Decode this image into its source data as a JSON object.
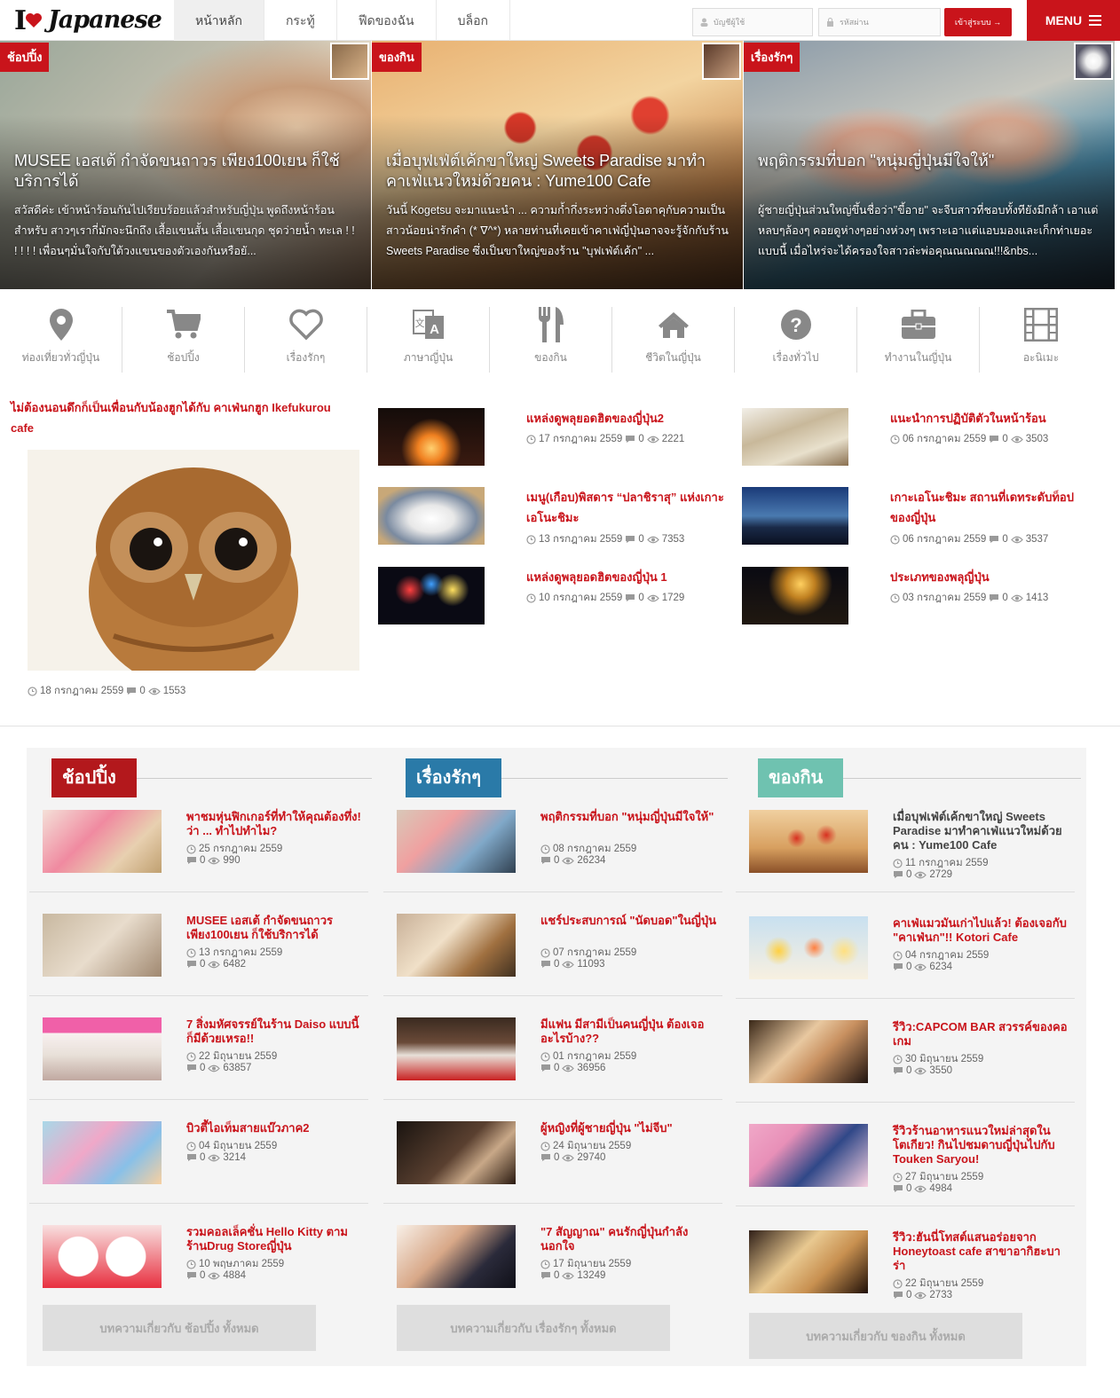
{
  "header": {
    "logo_text": "Japanese",
    "nav": [
      "หน้าหลัก",
      "กระทู้",
      "ฟีดของฉัน",
      "บล็อก"
    ],
    "username_placeholder": "บัญชีผู้ใช้",
    "password_placeholder": "รหัสผ่าน",
    "login_label": "เข้าสู่ระบบ →",
    "menu_label": "MENU"
  },
  "slides": [
    {
      "tag": "ช้อปปิ้ง",
      "title": "MUSEE เอสเต้ กำจัดขนถาวร เพียง100เยน ก็ใช้บริการได้",
      "excerpt": "สวัสดีค่ะ เข้าหน้าร้อนกันไปเรียบร้อยแล้วสำหรับญี่ปุ่น พูดถึงหน้าร้อนสำหรับ สาวๆเรากี่มักจะนึกถึง เสื้อแขนสั้น เสื้อแขนกุด ชุดว่ายน้ำ ทะเล ! ! ! ! ! ! เพื่อนๆมั่นใจกับใต้วงแขนของตัวเองกันหรือยั..."
    },
    {
      "tag": "ของกิน",
      "title": "เมื่อบุฟเฟ่ต์เค้กขาใหญ่ Sweets Paradise มาทำคาเฟ่แนวใหม่ด้วยคน : Yume100 Cafe",
      "excerpt": "วันนี้ Kogetsu จะมาแนะนำ ... ความก้ำกึ่งระหว่างตึ่งโอตาคุกับความเป็นสาวน้อยน่ารักคำ (* ∇^*) หลายท่านที่เคยเข้าคาเฟ่ญี่ปุ่นอาจจะรู้จักกับร้าน Sweets Paradise ซึ่งเป็นขาใหญ่ของร้าน \"บุฟเฟ่ต์เค้ก\" ..."
    },
    {
      "tag": "เรื่องรักๆ",
      "title": "พฤติกรรมที่บอก \"หนุ่มญี่ปุ่นมีใจให้\"",
      "excerpt": "ผู้ชายญี่ปุ่นส่วนใหญ่ขึ้นชื่อว่า\"ขี้อาย\" จะจีบสาวที่ชอบทั้งทียังมีกล้า เอาแต่หลบๆล้องๆ คอยดูห่างๆอย่างห่วงๆ เพราะเอาแต่แอบมองและเก็กท่าเยอะแบบนี้ เมื่อไหร่จะได้ครองใจสาวล่ะพ่อคุณณณณณ!!!&nbs..."
    }
  ],
  "categories": [
    "ท่องเที่ยวทั่วญี่ปุ่น",
    "ช้อปปิ้ง",
    "เรื่องรักๆ",
    "ภาษาญี่ปุ่น",
    "ของกิน",
    "ชีวิตในญี่ปุ่น",
    "เรื่องทั่วไป",
    "ทำงานในญี่ปุ่น",
    "อะนิเมะ"
  ],
  "featured": {
    "title": "ไม่ต้องนอนดึกก็เป็นเพื่อนกับน้องฮูกได้กับ คาเฟ่นกฮูก Ikefukurou cafe",
    "date": "18 กรกฎาคม 2559",
    "comments": "0",
    "views": "1553"
  },
  "latest": [
    {
      "title": "แหล่งดูพลุยอดฮิตของญี่ปุ่น2",
      "date": "17 กรกฎาคม 2559",
      "comments": "0",
      "views": "2221"
    },
    {
      "title": "แนะนำการปฏิบัติตัวในหน้าร้อน",
      "date": "06 กรกฎาคม 2559",
      "comments": "0",
      "views": "3503"
    },
    {
      "title": "เมนู(เกือบ)พิสดาร “ปลาชิราสุ” แห่งเกาะเอโนะชิมะ",
      "date": "13 กรกฎาคม 2559",
      "comments": "0",
      "views": "7353"
    },
    {
      "title": "เกาะเอโนะชิมะ สถานที่เดทระดับท็อปของญี่ปุ่น",
      "date": "06 กรกฎาคม 2559",
      "comments": "0",
      "views": "3537"
    },
    {
      "title": "แหล่งดูพลุยอดฮิตของญี่ปุ่น 1",
      "date": "10 กรกฎาคม 2559",
      "comments": "0",
      "views": "1729"
    },
    {
      "title": "ประเภทของพลุญี่ปุ่น",
      "date": "03 กรกฎาคม 2559",
      "comments": "0",
      "views": "1413"
    }
  ],
  "columns": [
    {
      "label": "ช้อปปิ้ง",
      "color": "#b3181c",
      "more": "บทความเกี่ยวกับ ช้อปปิ้ง ทั้งหมด",
      "posts": [
        {
          "title": "พาชมหุ่นฟิกเกอร์ที่ทำให้คุณต้องทึ่ง! ว่า ... ทำไปทำไม?",
          "date": "25 กรกฎาคม 2559",
          "comments": "0",
          "views": "990"
        },
        {
          "title": "MUSEE เอสเต้ กำจัดขนถาวร เพียง100เยน ก็ใช้บริการได้",
          "date": "13 กรกฎาคม 2559",
          "comments": "0",
          "views": "6482"
        },
        {
          "title": "7 สิ่งมหัศจรรย์ในร้าน Daiso แบบนี้ก็มีด้วยเหรอ!!",
          "date": "22 มิถุนายน 2559",
          "comments": "0",
          "views": "63857"
        },
        {
          "title": "บิวตี้ไอเท็มสายแบ๊วภาค2",
          "date": "04 มิถุนายน 2559",
          "comments": "0",
          "views": "3214"
        },
        {
          "title": "รวมคอลเล็คชั่น Hello Kitty ตามร้านDrug Storeญี่ปุ่น",
          "date": "10 พฤษภาคม 2559",
          "comments": "0",
          "views": "4884"
        }
      ]
    },
    {
      "label": "เรื่องรักๆ",
      "color": "#2a7aa8",
      "more": "บทความเกี่ยวกับ เรื่องรักๆ ทั้งหมด",
      "posts": [
        {
          "title": "พฤติกรรมที่บอก \"หนุ่มญี่ปุ่นมีใจให้\"",
          "date": "08 กรกฎาคม 2559",
          "comments": "0",
          "views": "26234"
        },
        {
          "title": "แชร์ประสบการณ์ \"นัดบอด\"ในญี่ปุ่น",
          "date": "07 กรกฎาคม 2559",
          "comments": "0",
          "views": "11093"
        },
        {
          "title": "มีแฟน มีสามีเป็นคนญี่ปุ่น ต้องเจออะไรบ้าง??",
          "date": "01 กรกฎาคม 2559",
          "comments": "0",
          "views": "36956"
        },
        {
          "title": "ผู้หญิงที่ผู้ชายญี่ปุ่น \"ไม่จีบ\"",
          "date": "24 มิถุนายน 2559",
          "comments": "0",
          "views": "29740"
        },
        {
          "title": "\"7 สัญญาณ\" คนรักญี่ปุ่นกำลังนอกใจ",
          "date": "17 มิถุนายน 2559",
          "comments": "0",
          "views": "13249"
        }
      ]
    },
    {
      "label": "ของกิน",
      "color": "#6fc2b0",
      "more": "บทความเกี่ยวกับ ของกิน ทั้งหมด",
      "posts": [
        {
          "title": "เมื่อบุฟเฟ่ต์เค้กขาใหญ่ Sweets Paradise มาทำคาเฟ่แนวใหม่ด้วยคน : Yume100 Cafe",
          "date": "11 กรกฎาคม 2559",
          "comments": "0",
          "views": "2729"
        },
        {
          "title": "คาเฟ่แมวมันเก่าไปแล้ว! ต้องเจอกับ \"คาเฟ่นก\"!! Kotori Cafe",
          "date": "04 กรกฎาคม 2559",
          "comments": "0",
          "views": "6234"
        },
        {
          "title": "รีวิว:CAPCOM BAR สวรรค์ของคอเกม",
          "date": "30 มิถุนายน 2559",
          "comments": "0",
          "views": "3550"
        },
        {
          "title": "รีวิวร้านอาหารแนวใหม่ล่าสุดในโตเกียว! กินไปชมดาบญี่ปุ่นไปกับ Touken Saryou!",
          "date": "27 มิถุนายน 2559",
          "comments": "0",
          "views": "4984"
        },
        {
          "title": "รีวิว:ฮันนี่โทสต์แสนอร่อยจาก Honeytoast cafe สาขาอากิฮะบาร่า",
          "date": "22 มิถุนายน 2559",
          "comments": "0",
          "views": "2733"
        }
      ]
    }
  ]
}
